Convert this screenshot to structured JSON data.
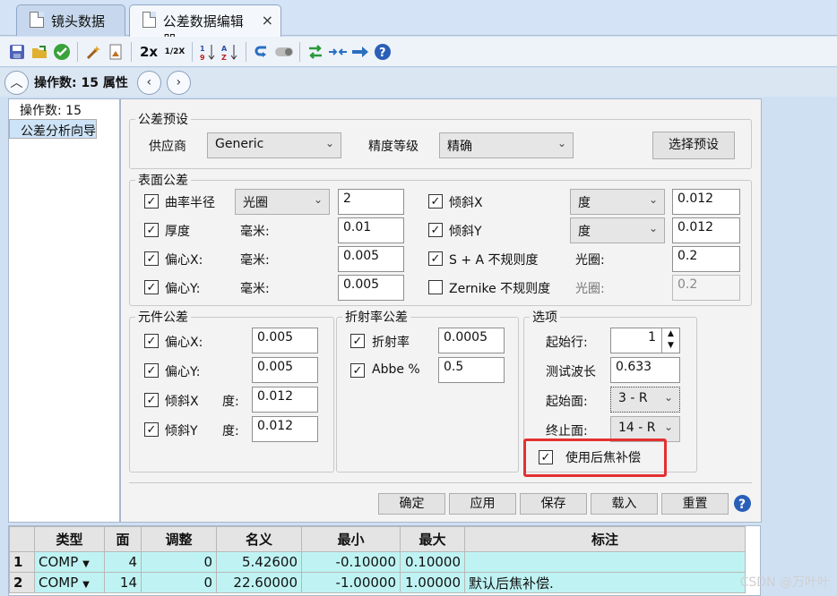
{
  "tabs": [
    {
      "label": "镜头数据"
    },
    {
      "label": "公差数据编辑器",
      "close": "×"
    }
  ],
  "toolbar": {
    "icons": [
      "save-icon",
      "open-folder-icon",
      "check-icon",
      "wand-icon",
      "doc-wizard-icon",
      "2x",
      "1/2X",
      "sort-num-icon",
      "sort-alpha-icon",
      "undo-icon",
      "toggle-icon",
      "swap-icon",
      "collapse-icon",
      "arrow-right-icon",
      "help-icon"
    ],
    "double": "2x",
    "half": "1/2X"
  },
  "opsbar": {
    "label": "操作数: 15 属性"
  },
  "leftnav": {
    "items": [
      "操作数: 15",
      "公差分析向导"
    ]
  },
  "preset": {
    "title": "公差预设",
    "vendor_label": "供应商",
    "vendor_value": "Generic",
    "grade_label": "精度等级",
    "grade_value": "精确",
    "select_button": "选择预设"
  },
  "surface": {
    "title": "表面公差",
    "radius_label": "曲率半径",
    "radius_unit": "光圈",
    "radius_value": "2",
    "thickness_label": "厚度",
    "thickness_unit": "毫米:",
    "thickness_value": "0.01",
    "decx_label": "偏心X:",
    "decx_unit": "毫米:",
    "decx_value": "0.005",
    "decy_label": "偏心Y:",
    "decy_unit": "毫米:",
    "decy_value": "0.005",
    "tiltx_label": "倾斜X",
    "tiltx_unit": "度",
    "tiltx_value": "0.012",
    "tilty_label": "倾斜Y",
    "tilty_unit": "度",
    "tilty_value": "0.012",
    "sa_label": "S + A 不规则度",
    "sa_unit": "光圈:",
    "sa_value": "0.2",
    "zern_label": "Zernike 不规则度",
    "zern_unit": "光圈:",
    "zern_value": "0.2"
  },
  "element": {
    "title": "元件公差",
    "decx_label": "偏心X:",
    "decx_value": "0.005",
    "decy_label": "偏心Y:",
    "decy_value": "0.005",
    "tiltx_label": "倾斜X",
    "tiltx_unit": "度:",
    "tiltx_value": "0.012",
    "tilty_label": "倾斜Y",
    "tilty_unit": "度:",
    "tilty_value": "0.012"
  },
  "index": {
    "title": "折射率公差",
    "n_label": "折射率",
    "n_value": "0.0005",
    "abbe_label": "Abbe %",
    "abbe_value": "0.5"
  },
  "options": {
    "title": "选项",
    "start_row_label": "起始行:",
    "start_row_value": "1",
    "wave_label": "测试波长",
    "wave_value": "0.633",
    "start_surf_label": "起始面:",
    "start_surf_value": "3 - R",
    "end_surf_label": "终止面:",
    "end_surf_value": "14 - R",
    "backfocus_label": "使用后焦补偿"
  },
  "buttons": {
    "ok": "确定",
    "apply": "应用",
    "save": "保存",
    "load": "载入",
    "reset": "重置"
  },
  "grid": {
    "headers": [
      "",
      "类型",
      "面",
      "调整",
      "名义",
      "最小",
      "最大",
      "标注"
    ],
    "rows": [
      [
        "1",
        "COMP",
        "4",
        "0",
        "5.42600",
        "-0.10000",
        "0.10000",
        ""
      ],
      [
        "2",
        "COMP",
        "14",
        "0",
        "22.60000",
        "-1.00000",
        "1.00000",
        "默认后焦补偿."
      ]
    ]
  },
  "watermark": "CSDN @万叶叶",
  "colors": {
    "highlight": "#e53030",
    "grid_row": "#bff3f3",
    "accent": "#2a6fc0"
  }
}
